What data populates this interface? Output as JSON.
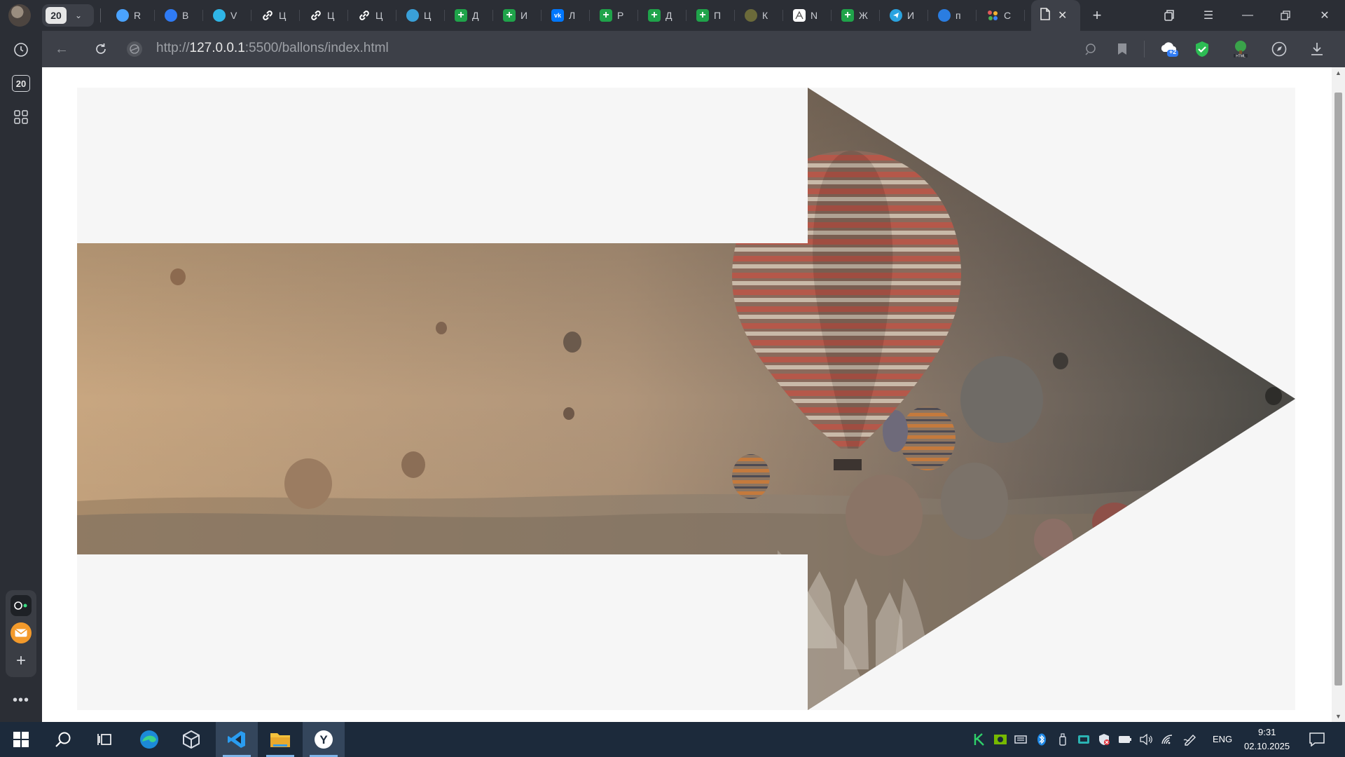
{
  "browser": {
    "tab_count": "20",
    "tabs": [
      {
        "letter": "R",
        "icon": "3d-sphere-icon",
        "color": "#4aa3ff"
      },
      {
        "letter": "B",
        "icon": "mail-icon",
        "color": "#2f7bf5"
      },
      {
        "letter": "V",
        "icon": "shield-heart-icon",
        "color": "#2fb5e6"
      },
      {
        "letter": "Ц",
        "icon": "link-icon",
        "color": "#ffffff"
      },
      {
        "letter": "Ц",
        "icon": "link-icon",
        "color": "#ffffff"
      },
      {
        "letter": "Ц",
        "icon": "link-icon",
        "color": "#ffffff"
      },
      {
        "letter": "Ц",
        "icon": "cloud-icon",
        "color": "#3aa0d8"
      },
      {
        "letter": "Д",
        "icon": "plus-square-icon",
        "color": "#1fa34a"
      },
      {
        "letter": "И",
        "icon": "plus-square-icon",
        "color": "#1fa34a"
      },
      {
        "letter": "Л",
        "icon": "vk-icon",
        "color": "#0077ff"
      },
      {
        "letter": "Р",
        "icon": "plus-square-icon",
        "color": "#1fa34a"
      },
      {
        "letter": "Д",
        "icon": "plus-square-icon",
        "color": "#1fa34a"
      },
      {
        "letter": "П",
        "icon": "plus-square-icon",
        "color": "#1fa34a"
      },
      {
        "letter": "К",
        "icon": "emblem-icon",
        "color": "#6b6a3a"
      },
      {
        "letter": "N",
        "icon": "sketch-icon",
        "color": "#ffffff"
      },
      {
        "letter": "Ж",
        "icon": "plus-square-icon",
        "color": "#1fa34a"
      },
      {
        "letter": "И",
        "icon": "telegram-icon",
        "color": "#2aa3e0"
      },
      {
        "letter": "п",
        "icon": "wave-icon",
        "color": "#2a7de1"
      },
      {
        "letter": "С",
        "icon": "dots-icon",
        "color": "#e05a5a"
      }
    ],
    "active_tab_icon": "document-icon",
    "url_scheme": "http://",
    "url_host": "127.0.0.1",
    "url_rest": ":5500/ballons/index.html",
    "rail_counter": "20",
    "weather_badge": "+2"
  },
  "page": {
    "background": "#f6f6f6",
    "shape": "arrow",
    "image": "hot-air-balloons-over-valley"
  },
  "taskbar": {
    "language": "ENG",
    "time": "9:31",
    "date": "02.10.2025"
  }
}
